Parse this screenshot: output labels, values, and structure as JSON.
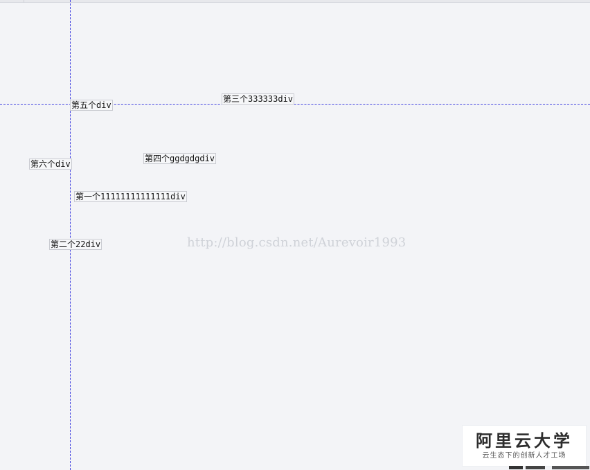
{
  "boxes": {
    "fifth": "第五个div",
    "third": "第三个333333div",
    "fourth": "第四个ggdgdgdiv",
    "sixth": "第六个div",
    "first": "第一个11111111111111div",
    "second": "第二个22div"
  },
  "watermark": "http://blog.csdn.net/Aurevoir1993",
  "logo": {
    "title": "阿里云大学",
    "subtitle": "云生态下的创新人才工场"
  },
  "colors": {
    "background": "#f3f4f7",
    "guide_line": "#3f3fe0",
    "box_border": "#c9cbd1",
    "watermark": "#cfd2d8"
  }
}
